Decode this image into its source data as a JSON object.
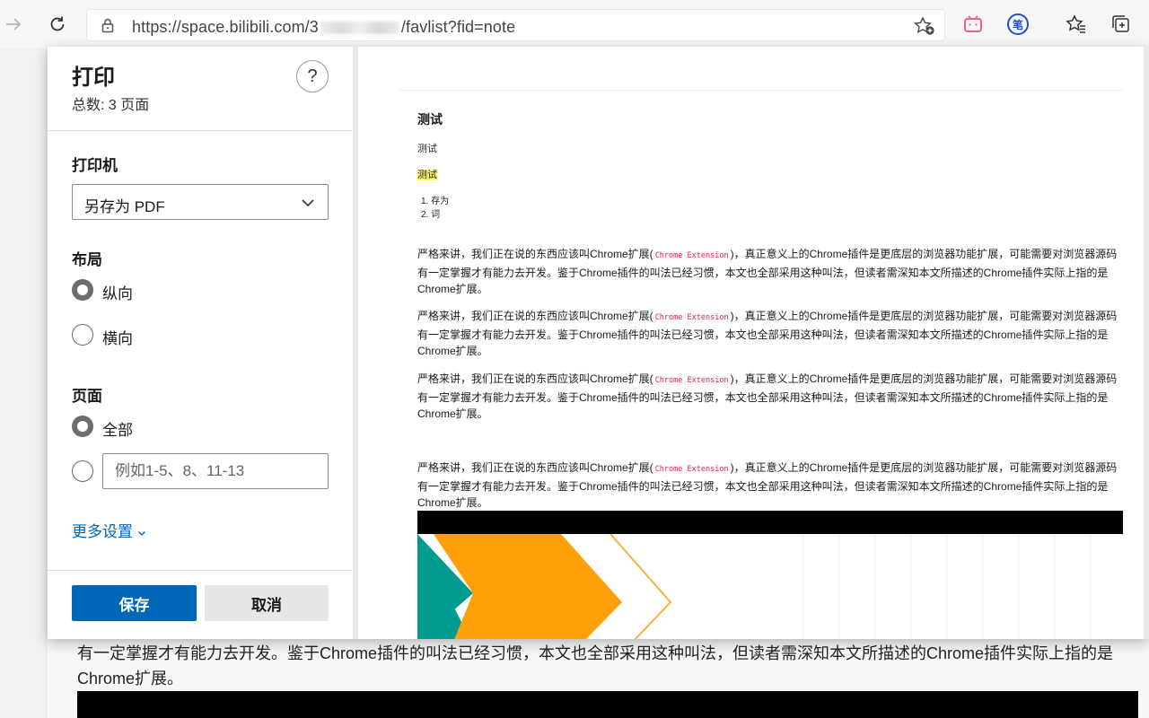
{
  "browser": {
    "url_prefix": "https://space.bilibili.com/",
    "url_hidden_prefix": "3",
    "url_suffix": "/favlist?fid=note",
    "ext_note_label": "笔"
  },
  "print_dialog": {
    "title": "打印",
    "total_pages": "总数: 3 页面",
    "help_label": "?",
    "printer_label": "打印机",
    "printer_value": "另存为 PDF",
    "layout_label": "布局",
    "layout_options": [
      {
        "label": "纵向",
        "selected": true
      },
      {
        "label": "横向",
        "selected": false
      }
    ],
    "pages_label": "页面",
    "pages_all_label": "全部",
    "pages_range_placeholder": "例如1-5、8、11-13",
    "more_settings": "更多设置",
    "save_label": "保存",
    "cancel_label": "取消"
  },
  "preview": {
    "heading": "测试",
    "line1": "测试",
    "line2_highlighted": "测试",
    "list": [
      "存为",
      "词"
    ],
    "para_prefix": "严格来讲，我们正在说的东西应该叫Chrome扩展(",
    "para_code": "Chrome Extension",
    "para_rest": ")，真正意义上的Chrome插件是更底层的浏览器功能扩展，可能需要对浏览器源码有一定掌握才有能力去开发。鉴于Chrome插件的叫法已经习惯，本文也全部采用这种叫法，但读者需深知本文所描述的Chrome插件实际上指的是Chrome扩展。"
  },
  "background_page": {
    "article_text": "有一定掌握才有能力去开发。鉴于Chrome插件的叫法已经习惯，本文也全部采用这种叫法，但读者需深知本文所描述的Chrome插件实际上指的是Chrome扩展。"
  },
  "colors": {
    "accent_blue": "#0067b8",
    "banner_teal": "#009a8e",
    "banner_orange": "#ffa00a",
    "highlight": "#fff56b",
    "code_pink": "#e0286a"
  }
}
